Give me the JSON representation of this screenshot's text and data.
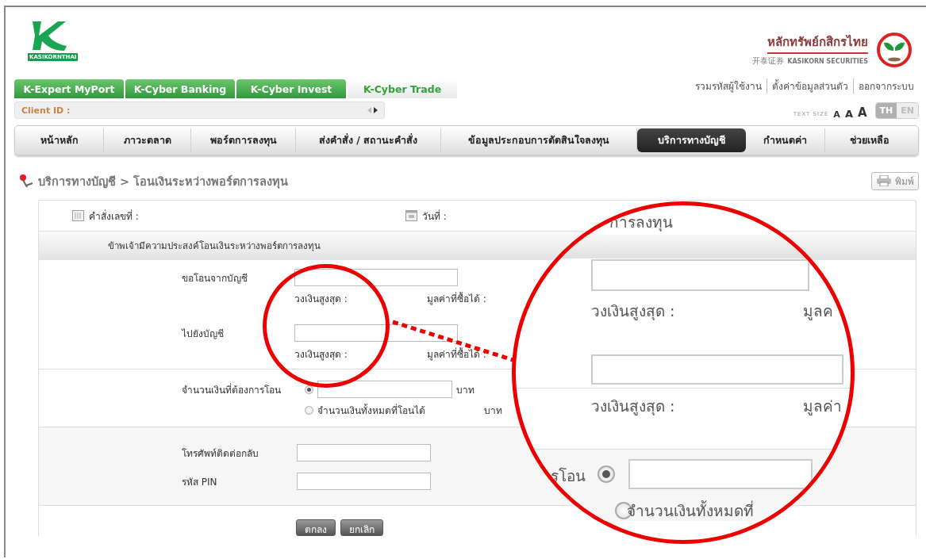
{
  "brand": {
    "logo_text": "KASIKORNTHAI",
    "company_thai": "หลักทรัพย์กสิกรไทย",
    "company_chinese": "开泰证券",
    "company_en": "KASIKORN SECURITIES"
  },
  "product_tabs": [
    {
      "label": "K-Expert MyPort",
      "selected": false
    },
    {
      "label": "K-Cyber Banking",
      "selected": false
    },
    {
      "label": "K-Cyber Invest",
      "selected": false
    },
    {
      "label": "K-Cyber Trade",
      "selected": true
    }
  ],
  "user_links": [
    "รวมรหัสผู้ใช้งาน",
    "ตั้งค่าข้อมูลส่วนตัว",
    "ออกจากระบบ"
  ],
  "client_id": {
    "label": "Client ID :"
  },
  "text_size": {
    "label": "TEXT SIZE",
    "sizes": [
      "A",
      "A",
      "A"
    ]
  },
  "languages": [
    {
      "label": "TH",
      "selected": true
    },
    {
      "label": "EN",
      "selected": false
    }
  ],
  "nav": [
    {
      "label": "หน้าหลัก",
      "selected": false
    },
    {
      "label": "ภาวะตลาด",
      "selected": false
    },
    {
      "label": "พอร์ตการลงทุน",
      "selected": false
    },
    {
      "label": "ส่งคำสั่ง / สถานะคำสั่ง",
      "selected": false
    },
    {
      "label": "ข้อมูลประกอบการตัดสินใจลงทุน",
      "selected": false
    },
    {
      "label": "บริการทางบัญชี",
      "selected": true
    },
    {
      "label": "กำหนดค่า",
      "selected": false
    },
    {
      "label": "ช่วยเหลือ",
      "selected": false
    }
  ],
  "breadcrumb": "บริการทางบัญชี > โอนเงินระหว่างพอร์ตการลงทุน",
  "print_button": "พิมพ์",
  "form": {
    "order_no_label": "คำสั่งเลขที่ :",
    "date_label": "วันที่ :",
    "intro": "ข้าพเจ้ามีความประสงค์โอนเงินระหว่างพอร์ตการลงทุน",
    "accounts": [
      {
        "label": "ขอโอนจากบัญชี",
        "limit_label": "วงเงินสูงสุด :",
        "buyable_label": "มูลค่าที่ซื้อได้ :"
      },
      {
        "label": "ไปยังบัญชี",
        "limit_label": "วงเงินสูงสุด :",
        "buyable_label": "มูลค่าที่ซื้อได้ :"
      }
    ],
    "amount": {
      "label": "จำนวนเงินที่ต้องการโอน",
      "options": [
        {
          "kind": "input",
          "selected": true,
          "unit": "บาท"
        },
        {
          "kind": "all",
          "label": "จำนวนเงินทั้งหมดที่โอนได้",
          "selected": false,
          "unit": "บาท"
        }
      ]
    },
    "phone_label": "โทรศัพท์ติดต่อกลับ",
    "pin_label": "รหัส PIN",
    "buttons": [
      "ตกลง",
      "ยกเลิก"
    ]
  },
  "magnifier": {
    "heading_fragment": "การลงทุน",
    "limit_labels": [
      "วงเงินสูงสุด :",
      "วงเงินสูงสุด :"
    ],
    "buyable_fragments": [
      "มูลค",
      "มูลค่า"
    ],
    "amount_label_fragment": "รโอน",
    "options": [
      {
        "selected": true
      },
      {
        "selected": false,
        "label_fragment": "จำนวนเงินทั้งหมดที่"
      }
    ]
  }
}
